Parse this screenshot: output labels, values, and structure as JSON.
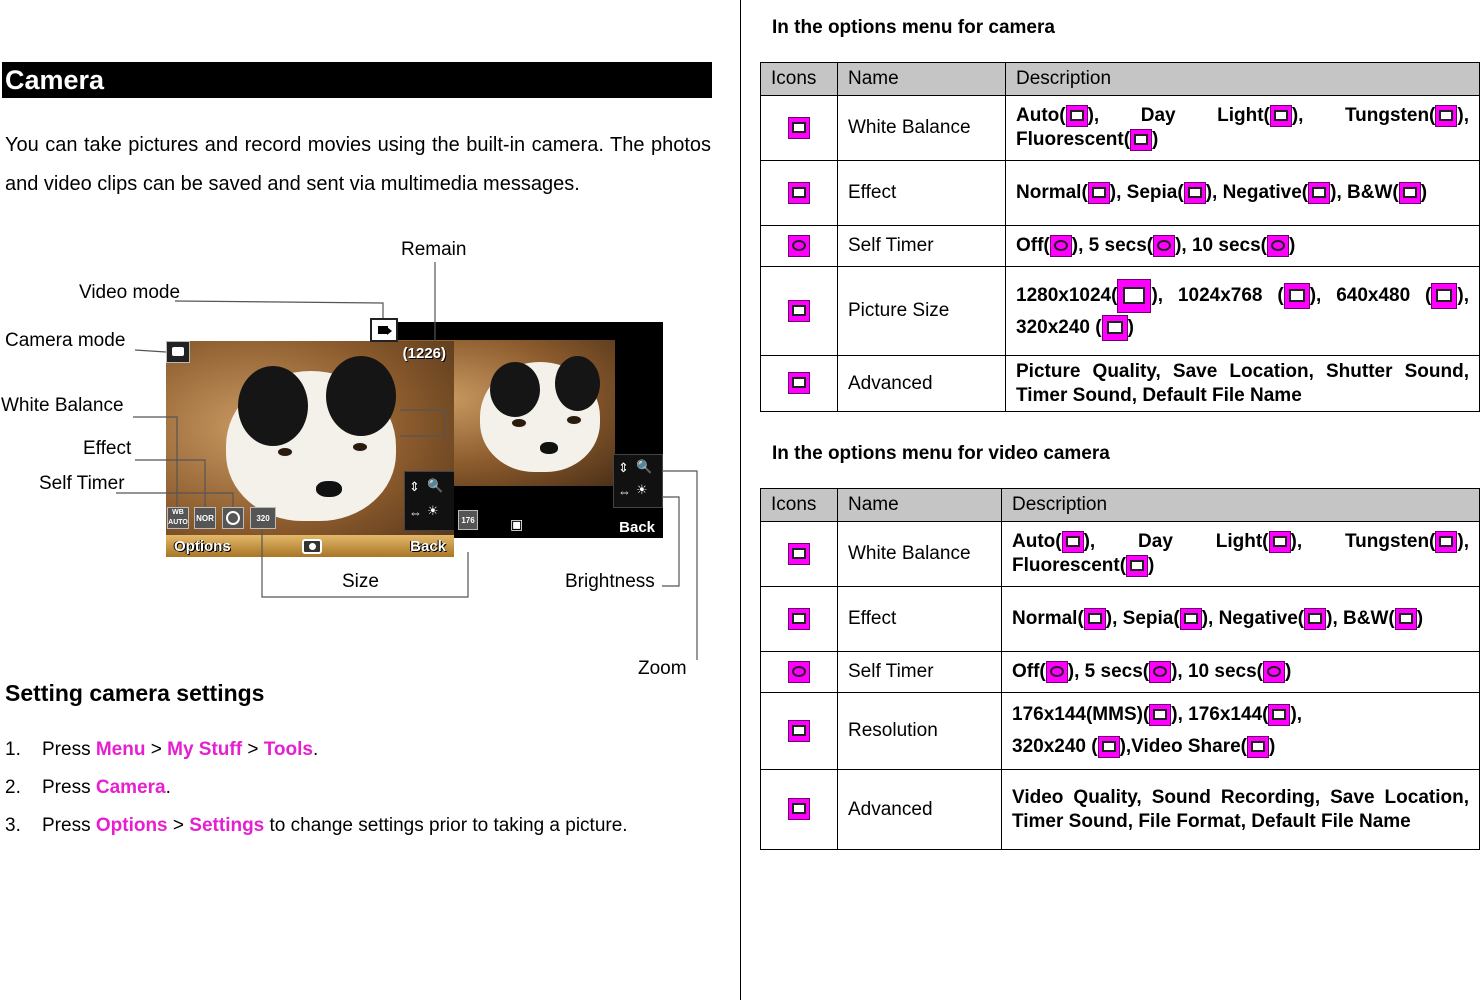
{
  "left": {
    "section_title": "Camera",
    "intro": "You can take pictures and record movies using the built-in camera. The photos and video clips can be saved and sent via multimedia messages.",
    "figure": {
      "labels": {
        "remain": "Remain",
        "video_mode": "Video mode",
        "camera_mode": "Camera mode",
        "white_balance": "White Balance",
        "effect": "Effect",
        "self_timer": "Self Timer",
        "size": "Size",
        "brightness": "Brightness",
        "zoom": "Zoom"
      },
      "screen_front": {
        "counter": "(1226)",
        "softkey_left": "Options",
        "softkey_right": "Back",
        "chip_wb": "WB AUTO",
        "chip_effect": "NOR",
        "chip_size": "320"
      },
      "screen_back": {
        "softkey_right": "Back",
        "chip_res": "176"
      }
    },
    "settings_heading": "Setting camera settings",
    "steps": [
      {
        "num": "1.",
        "pre": "Press ",
        "k1": "Menu",
        "s1": " > ",
        "k2": "My Stuff",
        "s2": " > ",
        "k3": "Tools",
        "post": "."
      },
      {
        "num": "2.",
        "pre": "Press ",
        "k1": "Camera",
        "post": "."
      },
      {
        "num": "3.",
        "pre": "Press ",
        "k1": "Options",
        "s1": " > ",
        "k2": "Settings",
        "post": " to change settings prior to taking a picture."
      }
    ]
  },
  "right": {
    "camera_heading": "In the options menu for camera",
    "video_heading": "In the options menu for video camera",
    "columns": [
      "Icons",
      "Name",
      "Description"
    ],
    "camera_rows": [
      {
        "icon": "white-balance-icon",
        "name": "White Balance",
        "desc_parts": [
          "Auto(",
          "), Day Light(",
          "), Tungsten(",
          "), Fluorescent(",
          ")"
        ]
      },
      {
        "icon": "effect-icon",
        "name": "Effect",
        "desc_parts": [
          "Normal(",
          "), Sepia(",
          "), Negative(",
          "), B&W(",
          ")"
        ]
      },
      {
        "icon": "self-timer-icon",
        "name": "Self Timer",
        "desc_parts": [
          "Off(",
          "), 5 secs(",
          "), 10 secs(",
          ")"
        ]
      },
      {
        "icon": "picture-size-icon",
        "name": "Picture Size",
        "desc_parts": [
          "1280x1024(",
          "), 1024x768 (",
          "), 640x480 (",
          "), 320x240 (",
          ")"
        ]
      },
      {
        "icon": "advanced-icon",
        "name": "Advanced",
        "desc": "Picture Quality, Save Location, Shutter Sound, Timer Sound, Default File Name"
      }
    ],
    "video_rows": [
      {
        "icon": "white-balance-icon",
        "name": "White Balance",
        "desc_parts": [
          "Auto(",
          "), Day Light(",
          "), Tungsten(",
          "), Fluorescent(",
          ")"
        ]
      },
      {
        "icon": "effect-icon",
        "name": "Effect",
        "desc_parts": [
          "Normal(",
          "), Sepia(",
          "), Negative(",
          "), B&W(",
          ")"
        ]
      },
      {
        "icon": "self-timer-icon",
        "name": "Self Timer",
        "desc_parts": [
          "Off(",
          "), 5 secs(",
          "), 10 secs(",
          ")"
        ]
      },
      {
        "icon": "resolution-icon",
        "name": "Resolution",
        "desc_parts": [
          "176x144(MMS)(",
          "), 176x144(",
          "),",
          "320x240 (",
          "),Video Share(",
          ")"
        ]
      },
      {
        "icon": "advanced-icon",
        "name": "Advanced",
        "desc": "Video Quality, Sound Recording, Save Location, Timer Sound, File Format, Default File Name"
      }
    ]
  },
  "colors": {
    "keyword": "#e61fd0",
    "icon_fill": "#ff00ff",
    "table_header": "#c5c5c5",
    "title_bar": "#000000"
  }
}
